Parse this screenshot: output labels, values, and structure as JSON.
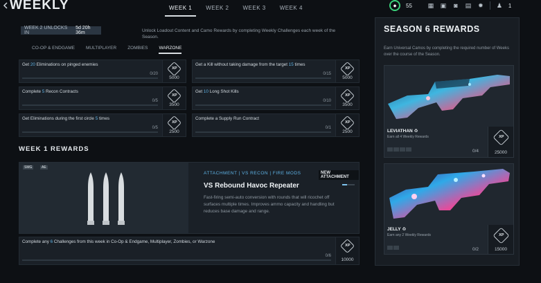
{
  "header": {
    "title": "WEEKLY",
    "week_tabs": [
      "WEEK 1",
      "WEEK 2",
      "WEEK 3",
      "WEEK 4"
    ],
    "level": "55",
    "notification_count": "1"
  },
  "unlock": {
    "label": "WEEK 2 UNLOCKS IN",
    "time": "5d 20h 36m",
    "intro": "Unlock Loadout Content and Camo Rewards by completing Weekly Challenges each week of the Season."
  },
  "mode_tabs": [
    "CO-OP & ENDGAME",
    "MULTIPLAYER",
    "ZOMBIES",
    "WARZONE"
  ],
  "challenges": [
    {
      "pre": "Get ",
      "num": "20",
      "post": " Eliminations on pinged enemies",
      "progress": "0/20",
      "xp": "5000"
    },
    {
      "pre": "Get a Kill without taking damage from the target ",
      "num": "15",
      "post": " times",
      "progress": "0/15",
      "xp": "5000"
    },
    {
      "pre": "Complete ",
      "num": "5",
      "post": " Recon Contracts",
      "progress": "0/5",
      "xp": "3500"
    },
    {
      "pre": "Get ",
      "num": "10",
      "post": " Long Shot Kills",
      "progress": "0/10",
      "xp": "3500"
    },
    {
      "pre": "Get Eliminations during the first circle ",
      "num": "5",
      "post": " times",
      "progress": "0/5",
      "xp": "2500"
    },
    {
      "pre": "Complete a Supply Run Contract",
      "num": "",
      "post": "",
      "progress": "0/1",
      "xp": "2500"
    }
  ],
  "xp_label": "XP",
  "week_rewards": {
    "title": "WEEK 1 REWARDS",
    "tag1": "SMG",
    "tag2": "AE",
    "category": "ATTACHMENT  |  VS RECON  |  FIRE MODS",
    "badge": "NEW ATTACHMENT",
    "name": "VS Rebound Havoc Repeater",
    "description": "Fast-firing semi-auto conversion with rounds that will ricochet off surfaces multiple times. Improves ammo capacity and handling but reduces base damage and range."
  },
  "bottom_challenge": {
    "pre": "Complete any ",
    "num": "6",
    "post": " Challenges from this week in Co-Op & Endgame, Multiplayer, Zombies, or Warzone",
    "progress": "0/6",
    "xp": "10000"
  },
  "season": {
    "title": "SEASON 6 REWARDS",
    "description": "Earn Universal Camos by completing the required number of Weeks over the course of the Season.",
    "camos": [
      {
        "name": "LEVIATHAN",
        "sub": "Earn all 4 Weekly Rewards",
        "progress": "0/4",
        "xp": "25000"
      },
      {
        "name": "JELLY",
        "sub": "Earn any 2 Weekly Rewards",
        "progress": "0/2",
        "xp": "15000"
      }
    ]
  }
}
